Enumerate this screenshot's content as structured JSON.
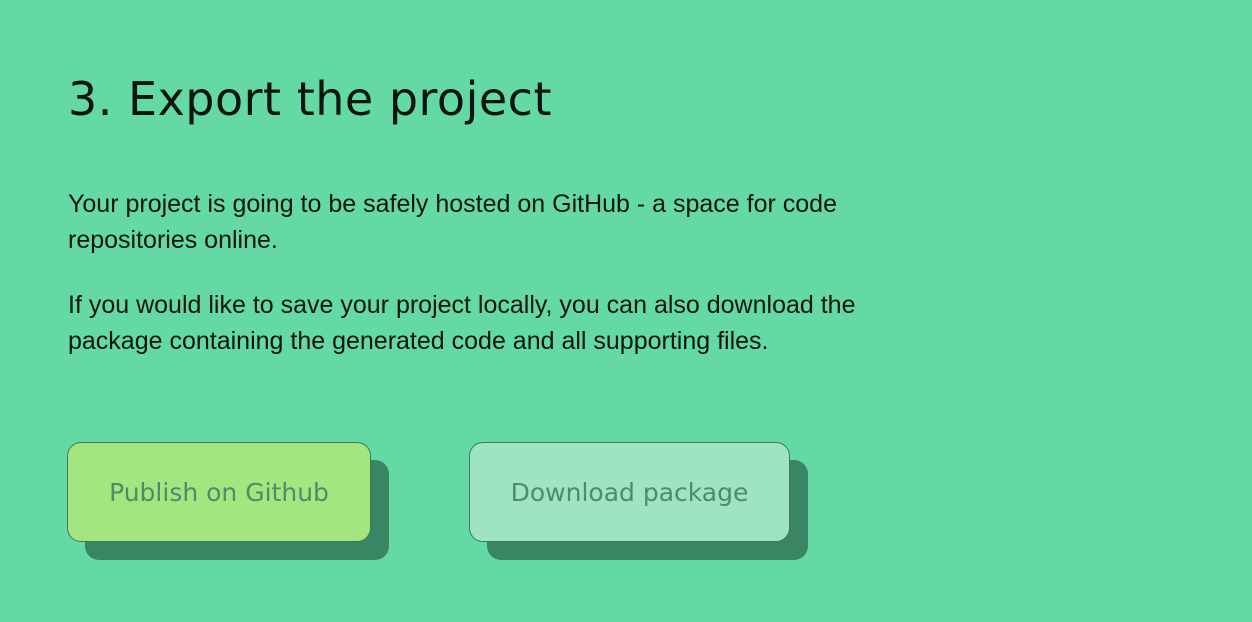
{
  "section": {
    "title": "3. Export the project",
    "paragraphs": [
      "Your project is going to be safely hosted on GitHub - a space for code repositories online.",
      "If you would like to save your project locally, you can also download the package containing the generated code and all supporting files."
    ]
  },
  "actions": {
    "publish_label": "Publish on Github",
    "download_label": "Download package"
  },
  "colors": {
    "background": "#64d9a4",
    "publish_button": "#a3e57e",
    "download_button": "#9ee3c4",
    "button_shadow": "#3a8563",
    "button_text": "#4f8a6c"
  }
}
